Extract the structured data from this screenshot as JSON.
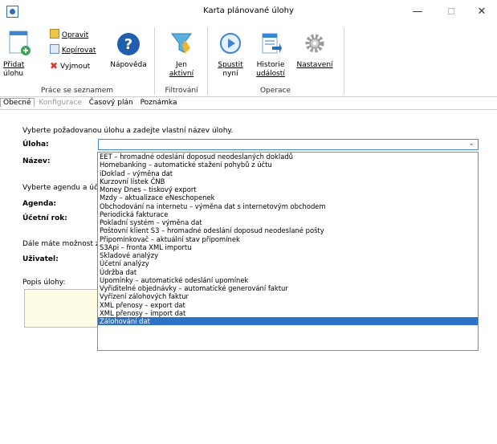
{
  "window": {
    "title": "Karta plánované úlohy",
    "minimize": "—",
    "maximize": "☐",
    "close": "✕"
  },
  "ribbon": {
    "new_task": [
      "Přidat",
      "úlohu"
    ],
    "edit": "Opravit",
    "copy": "Kopírovat",
    "delete": "Vyjmout",
    "help": "Nápověda",
    "group_list": "Práce se seznamem",
    "only_active": [
      "Jen",
      "aktivní"
    ],
    "group_filter": "Filtrování",
    "run": [
      "Spustit",
      "nyní"
    ],
    "history": [
      "Historie",
      "událostí"
    ],
    "settings": "Nastavení",
    "group_ops": "Operace"
  },
  "tabs": [
    "Obecné",
    "Konfigurace",
    "Časový plán",
    "Poznámka"
  ],
  "form": {
    "intro": "Vyberte požadovanou úlohu a zadejte vlastní název úlohy.",
    "task_label": "Úloha:",
    "name_label": "Název:",
    "agenda_intro": "Vyberte agendu a úče",
    "agenda_label": "Agenda:",
    "year_label": "Účetní rok:",
    "user_intro": "Dále máte možnost zv",
    "user_label": "Uživatel:",
    "desc_label": "Popis úlohy:",
    "combo_value": ""
  },
  "dropdown": {
    "selected_index": 22,
    "items": [
      "EET – hromadné odeslání doposud neodeslaných dokladů",
      "Homebanking – automatické stažení pohybů z účtu",
      "iDoklad – výměna dat",
      "Kurzovní lístek ČNB",
      "Money Dnes – tiskový export",
      "Mzdy – aktualizace eNeschopenek",
      "Obchodování na internetu – výměna dat s internetovým obchodem",
      "Periodická fakturace",
      "Pokladní systém – výměna dat",
      "Poštovní klient S3 – hromadné odeslání doposud neodeslané pošty",
      "Připomínkovač – aktuální stav připomínek",
      "S3Api – fronta XML importu",
      "Skladové analýzy",
      "Účetní analýzy",
      "Údržba dat",
      "Upomínky – automatické odeslání upomínek",
      "Vyřiditelné objednávky – automatické generování faktur",
      "Vyřízení zálohových faktur",
      "XML přenosy – export dat",
      "XML přenosy – import dat",
      "Zálohování dat"
    ]
  },
  "colors": {
    "accent": "#2e72c6",
    "help_icon": "#1f5fae",
    "delete_icon": "#d9372b"
  }
}
